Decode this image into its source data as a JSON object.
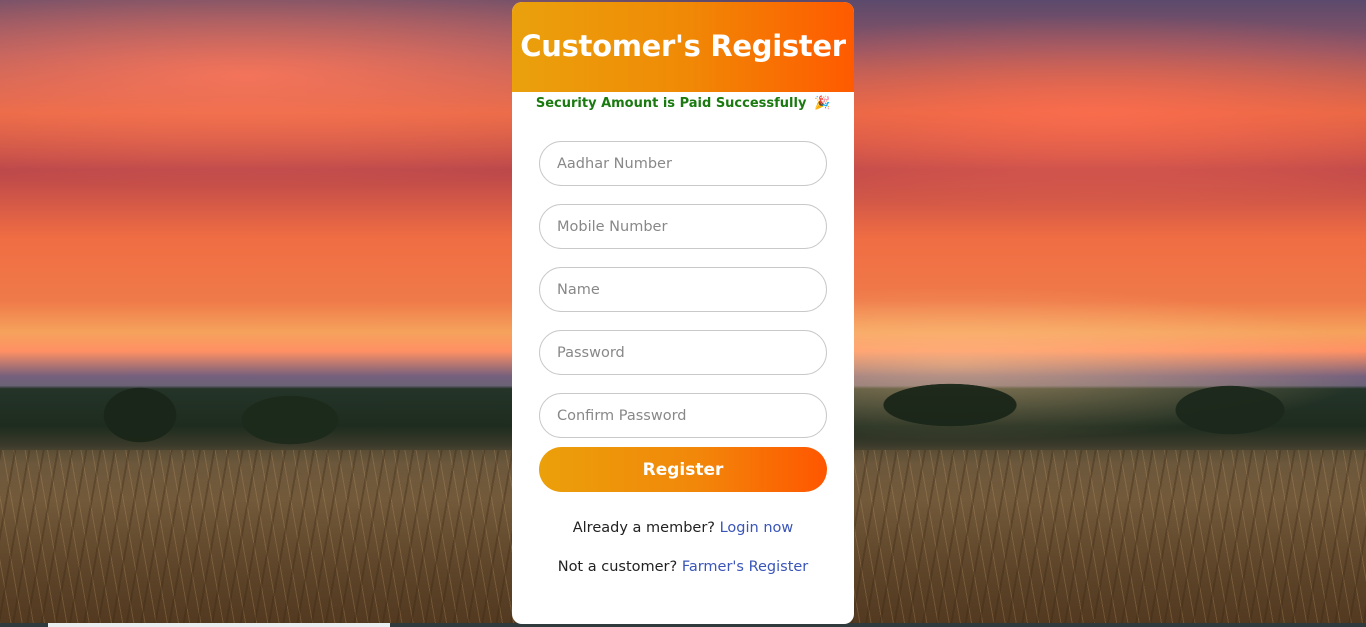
{
  "header": {
    "title": "Customer's Register"
  },
  "status_message": {
    "text": "Security Amount is Paid Successfully",
    "icon": "party-popper-icon",
    "emoji": "🎉",
    "color": "#1a7a10"
  },
  "form": {
    "aadhar_placeholder": "Aadhar Number",
    "mobile_placeholder": "Mobile Number",
    "name_placeholder": "Name",
    "password_placeholder": "Password",
    "confirm_password_placeholder": "Confirm Password",
    "submit_label": "Register"
  },
  "login_prompt": {
    "text": "Already a member?",
    "link": "Login now"
  },
  "farmer_prompt": {
    "text": "Not a customer?",
    "link": "Farmer's Register"
  },
  "colors": {
    "accent_start": "#eaa10c",
    "accent_end": "#ff5a00",
    "link": "#3a55b8"
  }
}
